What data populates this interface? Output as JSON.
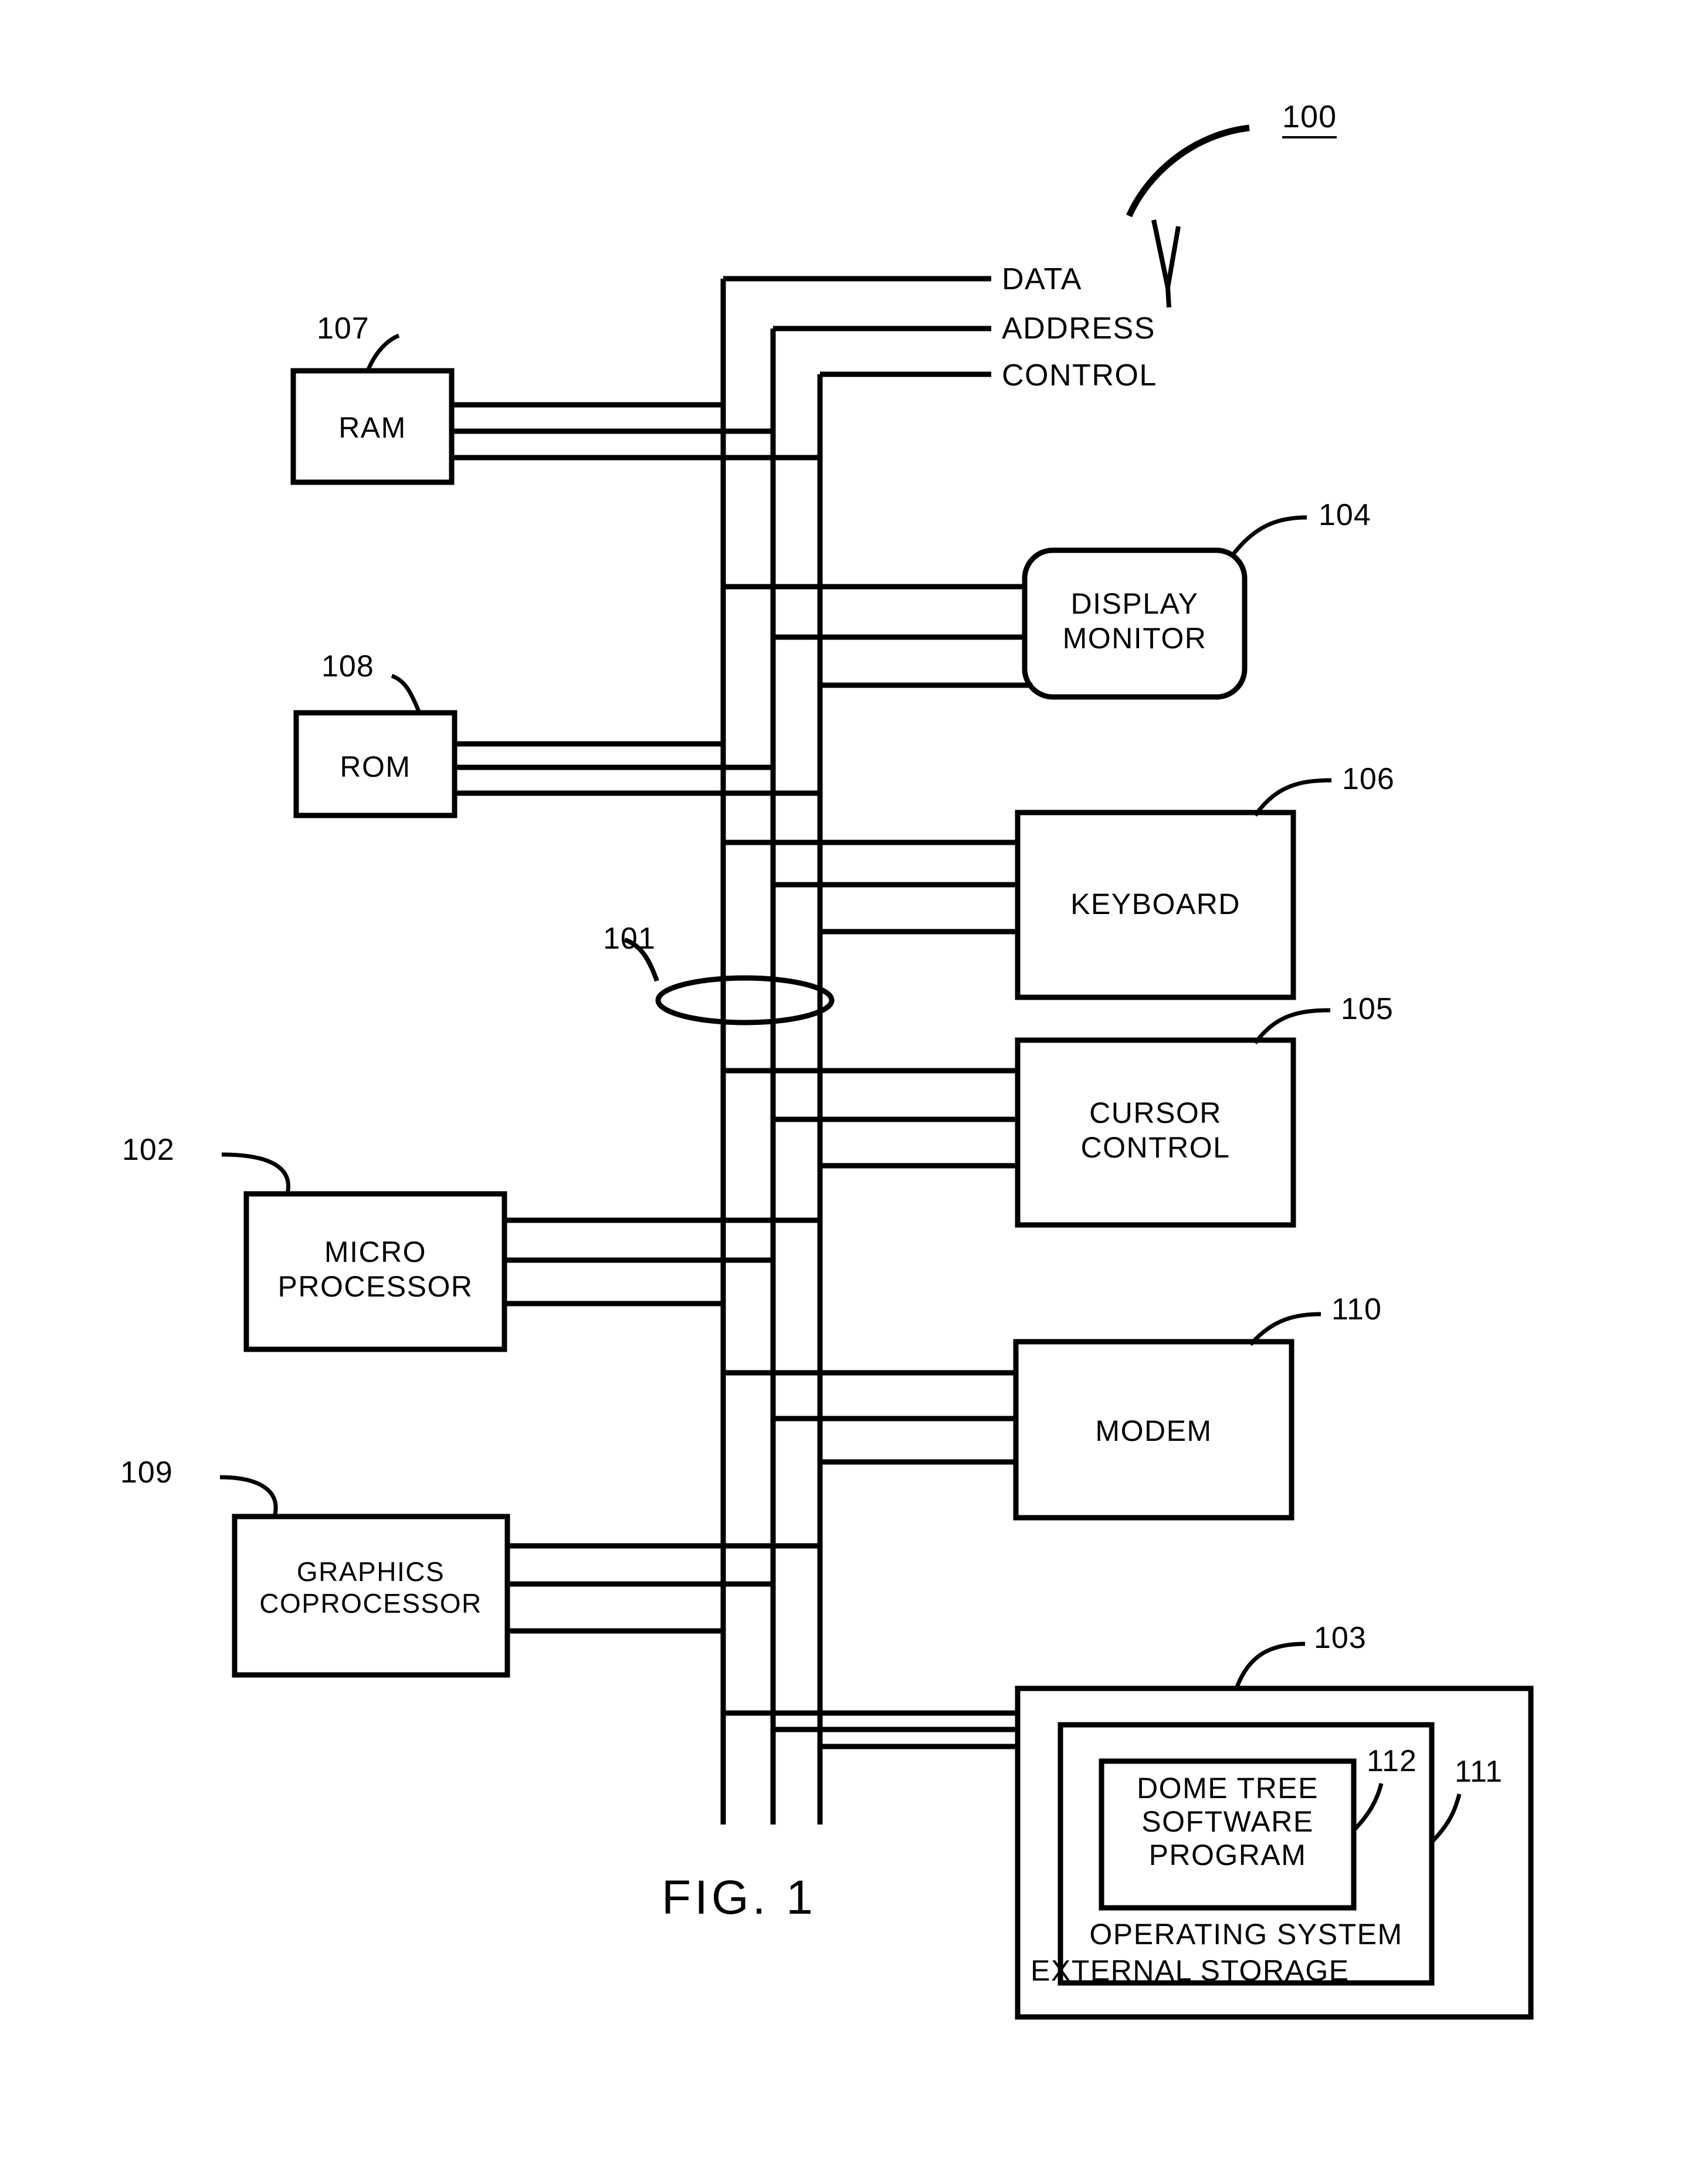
{
  "figure": {
    "caption": "FIG. 1",
    "system_ref": "100"
  },
  "bus": {
    "ref": "101",
    "lines": [
      {
        "name": "DATA"
      },
      {
        "name": "ADDRESS"
      },
      {
        "name": "CONTROL"
      }
    ]
  },
  "blocks": [
    {
      "id": "ram",
      "label": "RAM",
      "ref": "107"
    },
    {
      "id": "rom",
      "label": "ROM",
      "ref": "108"
    },
    {
      "id": "micro",
      "label_line1": "MICRO",
      "label_line2": "PROCESSOR",
      "ref": "102"
    },
    {
      "id": "graphics",
      "label_line1": "GRAPHICS",
      "label_line2": "COPROCESSOR",
      "ref": "109"
    },
    {
      "id": "display",
      "label_line1": "DISPLAY",
      "label_line2": "MONITOR",
      "ref": "104"
    },
    {
      "id": "keyboard",
      "label": "KEYBOARD",
      "ref": "106"
    },
    {
      "id": "cursor",
      "label_line1": "CURSOR",
      "label_line2": "CONTROL",
      "ref": "105"
    },
    {
      "id": "modem",
      "label": "MODEM",
      "ref": "110"
    },
    {
      "id": "storage",
      "label": "EXTERNAL STORAGE",
      "ref": "103"
    },
    {
      "id": "os",
      "label": "OPERATING SYSTEM",
      "ref": "111"
    },
    {
      "id": "program",
      "label_line1": "DOME TREE",
      "label_line2": "SOFTWARE",
      "label_line3": "PROGRAM",
      "ref": "112"
    }
  ],
  "colors": {
    "ink": "#000000",
    "paper": "#ffffff"
  }
}
